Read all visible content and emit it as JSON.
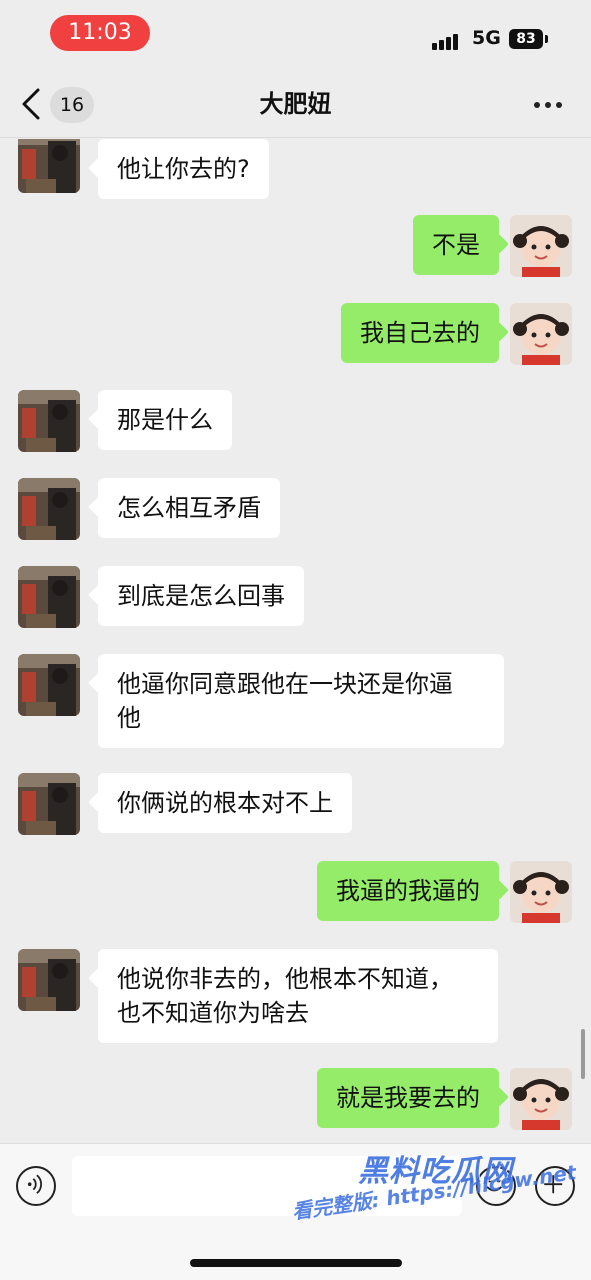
{
  "status_bar": {
    "time": "11:03",
    "network": "5G",
    "battery": "83"
  },
  "nav": {
    "unread_count": "16",
    "title": "大肥妞"
  },
  "messages": [
    {
      "side": "in",
      "text": "他让你去的?"
    },
    {
      "side": "out",
      "text": "不是"
    },
    {
      "side": "out",
      "text": "我自己去的"
    },
    {
      "side": "in",
      "text": "那是什么"
    },
    {
      "side": "in",
      "text": "怎么相互矛盾"
    },
    {
      "side": "in",
      "text": "到底是怎么回事"
    },
    {
      "side": "in",
      "text": "他逼你同意跟他在一块还是你逼\n他"
    },
    {
      "side": "in",
      "text": "你俩说的根本对不上"
    },
    {
      "side": "out",
      "text": "我逼的我逼的"
    },
    {
      "side": "in",
      "text": "他说你非去的，他根本不知道，\n也不知道你为啥去"
    },
    {
      "side": "out",
      "text": "就是我要去的"
    }
  ],
  "input": {
    "value": "",
    "placeholder": ""
  },
  "icons": {
    "back": "chevron-left-icon",
    "more": "more-dots-icon",
    "voice": "voice-icon",
    "emoji": "emoji-icon",
    "plus": "plus-icon"
  },
  "watermark": {
    "logo": "黑料吃瓜网",
    "url": "看完整版: https://hlcgw.net"
  },
  "colors": {
    "outgoing_bubble": "#95ec69",
    "incoming_bubble": "#ffffff",
    "time_pill": "#f04040",
    "background": "#ededed"
  }
}
